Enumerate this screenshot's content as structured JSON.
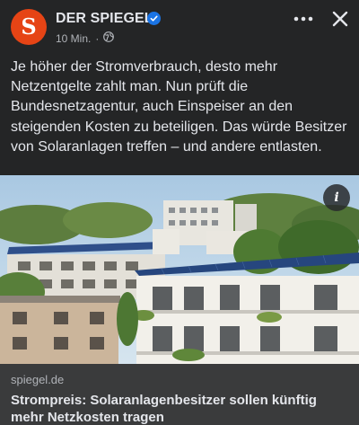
{
  "post": {
    "page_name": "DER SPIEGEL",
    "avatar_letter": "S",
    "verified": true,
    "timestamp": "10 Min.",
    "separator": "·",
    "privacy_icon": "globe-icon",
    "more_icon": "more-dots-icon",
    "close_icon": "close-icon",
    "text": "Je höher der Stromverbrauch, desto mehr Netzentgelte zahlt man. Nun prüft die Bundesnetzagentur, auch Einspeiser an den steigenden Kosten zu beteiligen. Das würde Besitzer von Solaranlagen treffen – und andere entlasten."
  },
  "image": {
    "info_icon": "i"
  },
  "link": {
    "domain": "spiegel.de",
    "headline": "Strompreis: Solaranlagenbesitzer sollen künftig mehr Netzkosten tragen"
  },
  "colors": {
    "background": "#242526",
    "link_box": "#3a3b3c",
    "brand": "#e64415",
    "verified": "#1b74e4"
  }
}
